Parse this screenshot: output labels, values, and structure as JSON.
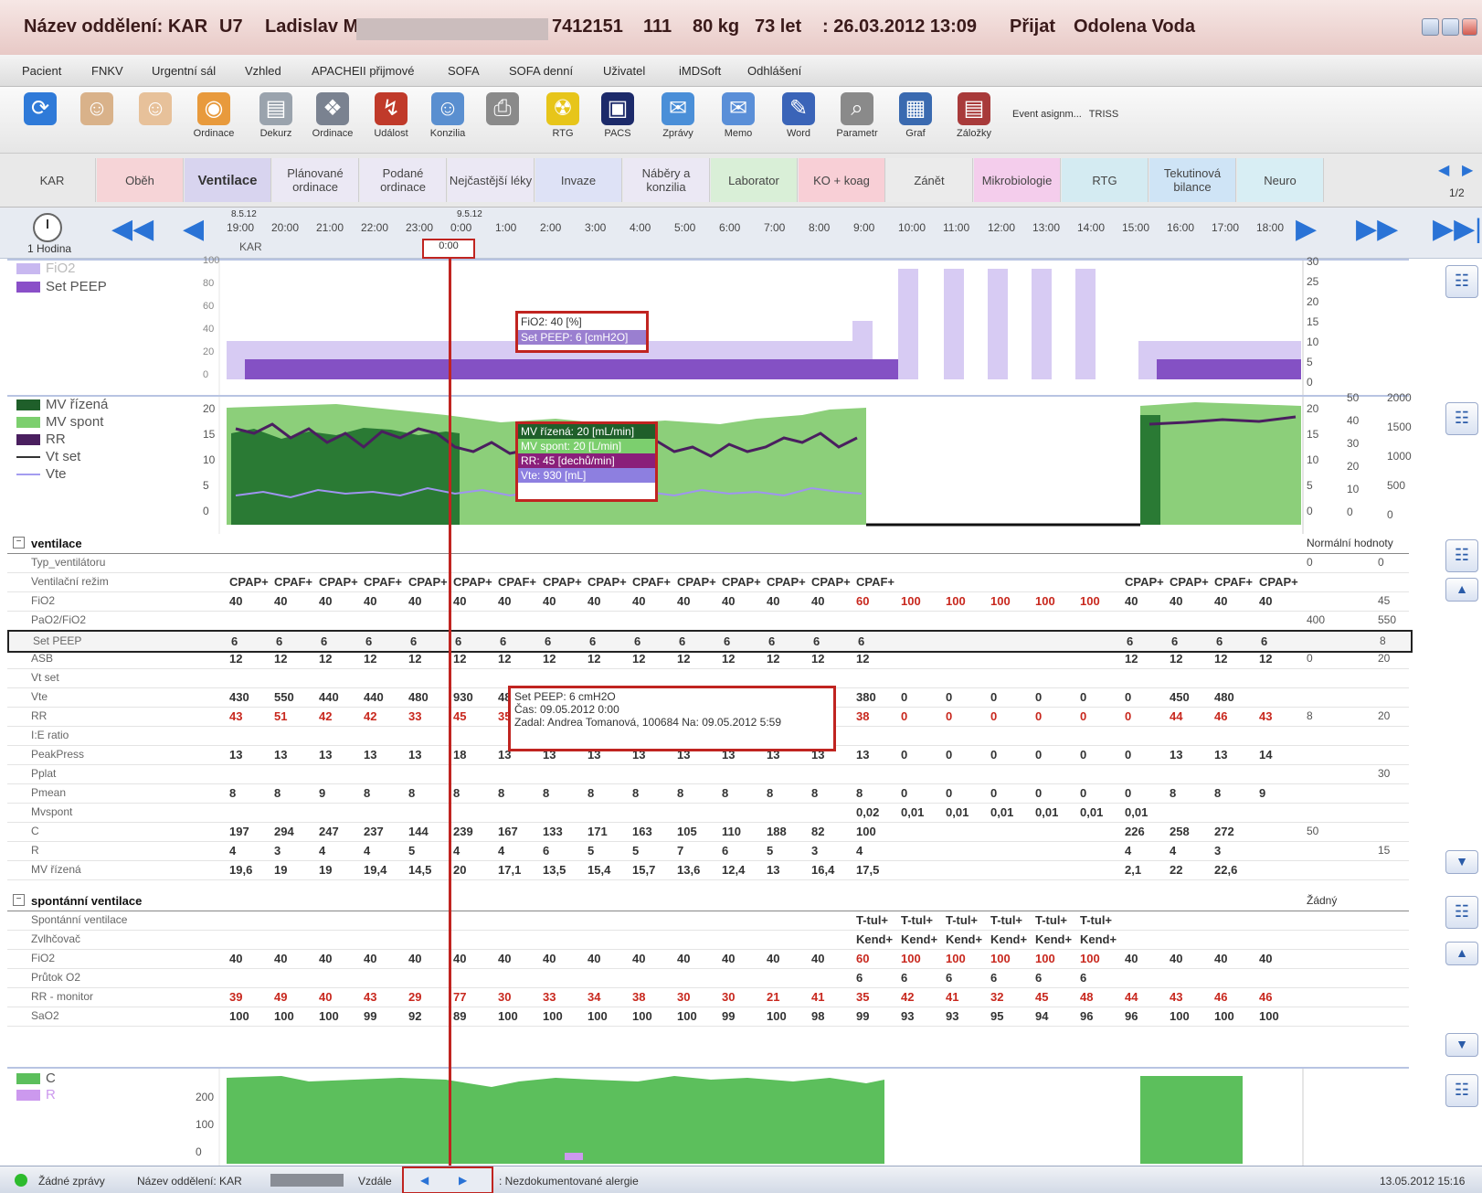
{
  "titlebar": {
    "department": "Název oddělení: KAR",
    "room": "U7",
    "patient": "Ladislav M.",
    "id": "7412151",
    "code": "111",
    "weight": "80 kg",
    "age": "73 let",
    "admitted": ": 26.03.2012 13:09",
    "status": "Přijat",
    "origin": "Odolena Voda"
  },
  "menu": [
    "Pacient",
    "FNKV",
    "Urgentní sál",
    "Vzhled",
    "APACHEII přijmové",
    "SOFA",
    "SOFA denní",
    "Uživatel",
    "iMDSoft",
    "Odhlášení"
  ],
  "toolbar": [
    "",
    "",
    "",
    "Ordinace",
    "Dekurz",
    "Ordinace",
    "Událost",
    "Konzilia",
    "",
    "RTG",
    "PACS",
    "Zprávy",
    "Memo",
    "Word",
    "Parametr",
    "Graf",
    "Záložky",
    "Event asignm...",
    "TRISS"
  ],
  "tabs": [
    {
      "label": "KAR",
      "color": "#e9e9e9"
    },
    {
      "label": "Oběh",
      "color": "#f6d4d7"
    },
    {
      "label": "Ventilace",
      "color": "#d8d4ef",
      "active": true
    },
    {
      "label": "Plánované ordinace",
      "color": "#ebe8f4"
    },
    {
      "label": "Podané ordinace",
      "color": "#ebe8f4"
    },
    {
      "label": "Nejčastější léky",
      "color": "#ebe8f4"
    },
    {
      "label": "Invaze",
      "color": "#dee2f6"
    },
    {
      "label": "Náběry a konzilia",
      "color": "#ebe8f4"
    },
    {
      "label": "Laborator",
      "color": "#d9efd7"
    },
    {
      "label": "KO + koag",
      "color": "#f8cfd6"
    },
    {
      "label": "Zánět",
      "color": "#ebebeb"
    },
    {
      "label": "Mikrobiologie",
      "color": "#f4cdec"
    },
    {
      "label": "RTG",
      "color": "#d4ebf2"
    },
    {
      "label": "Tekutinová bilance",
      "color": "#cfe4f6"
    },
    {
      "label": "Neuro",
      "color": "#d8eef4"
    }
  ],
  "tab_page": "1/2",
  "timebar": {
    "interval": "1 Hodina",
    "date1": "8.5.12",
    "date2": "9.5.12",
    "unit": "KAR",
    "cursor": "0:00",
    "hours": [
      "19:00",
      "20:00",
      "21:00",
      "22:00",
      "23:00",
      "0:00",
      "1:00",
      "2:00",
      "3:00",
      "4:00",
      "5:00",
      "6:00",
      "7:00",
      "8:00",
      "9:00",
      "10:00",
      "11:00",
      "12:00",
      "13:00",
      "14:00",
      "15:00",
      "16:00",
      "17:00",
      "18:00"
    ]
  },
  "chart1": {
    "legend": [
      {
        "name": "FiO2",
        "color": "#c8b8f0"
      },
      {
        "name": "Set PEEP",
        "color": "#8a4fc8"
      }
    ],
    "left_ticks": [
      "100",
      "80",
      "60",
      "40",
      "20",
      "0"
    ],
    "right_ticks": [
      "30",
      "25",
      "20",
      "15",
      "10",
      "5",
      "0"
    ],
    "tooltip": [
      "FiO2: 40 [%]",
      "Set PEEP: 6 [cmH2O]"
    ]
  },
  "chart2": {
    "legend": [
      {
        "name": "MV řízená",
        "color": "#1f5f2a"
      },
      {
        "name": "MV spont",
        "color": "#7ccf6e"
      },
      {
        "name": "RR",
        "color": "#4a1f5f"
      },
      {
        "name": "Vt set",
        "color": "#333333"
      },
      {
        "name": "Vte",
        "color": "#a49cf0"
      }
    ],
    "left_ticks": [
      "20",
      "15",
      "10",
      "5",
      "0"
    ],
    "right1": [
      "20",
      "15",
      "10",
      "5",
      "0"
    ],
    "right2": [
      "50",
      "40",
      "30",
      "20",
      "10",
      "0"
    ],
    "right3": [
      "2000",
      "1500",
      "1000",
      "500",
      "0"
    ],
    "tooltip": [
      "MV řízená: 20 [mL/min]",
      "MV spont: 20 [L/min]",
      "RR: 45 [dechů/min]",
      "Vte: 930 [mL]"
    ]
  },
  "ventilace": {
    "title": "ventilace",
    "normal_header": "Normální hodnoty",
    "rows": [
      {
        "label": "Typ_ventilátoru",
        "v": [],
        "n1": "0",
        "n2": "0"
      },
      {
        "label": "Ventilační režim",
        "v": [
          "CPAP+",
          "CPAF+",
          "CPAP+",
          "CPAF+",
          "CPAP+",
          "CPAP+",
          "CPAF+",
          "CPAP+",
          "CPAP+",
          "CPAF+",
          "CPAP+",
          "CPAP+",
          "CPAP+",
          "CPAP+",
          "CPAF+",
          "",
          "",
          "",
          "",
          "",
          "CPAP+",
          "CPAP+",
          "CPAF+",
          "CPAP+"
        ],
        "n1": "",
        "n2": ""
      },
      {
        "label": "FiO2",
        "v": [
          "40",
          "40",
          "40",
          "40",
          "40",
          "40",
          "40",
          "40",
          "40",
          "40",
          "40",
          "40",
          "40",
          "40",
          "60",
          "100",
          "100",
          "100",
          "100",
          "100",
          "40",
          "40",
          "40",
          "40"
        ],
        "red": [
          14,
          15,
          16,
          17,
          18,
          19
        ],
        "n1": "",
        "n2": "45"
      },
      {
        "label": "PaO2/FiO2",
        "v": [],
        "n1": "400",
        "n2": "550"
      },
      {
        "label": "Set PEEP",
        "v": [
          "6",
          "6",
          "6",
          "6",
          "6",
          "6",
          "6",
          "6",
          "6",
          "6",
          "6",
          "6",
          "6",
          "6",
          "6",
          "",
          "",
          "",
          "",
          "",
          "6",
          "6",
          "6",
          "6"
        ],
        "n1": "",
        "n2": "8"
      },
      {
        "label": "ASB",
        "v": [
          "12",
          "12",
          "12",
          "12",
          "12",
          "12",
          "12",
          "12",
          "12",
          "12",
          "12",
          "12",
          "12",
          "12",
          "12",
          "",
          "",
          "",
          "",
          "",
          "12",
          "12",
          "12",
          "12"
        ],
        "n1": "0",
        "n2": "20"
      },
      {
        "label": "Vt set",
        "v": [],
        "n1": "",
        "n2": ""
      },
      {
        "label": "Vte",
        "v": [
          "430",
          "550",
          "440",
          "440",
          "480",
          "930",
          "48",
          "",
          "",
          "",
          "",
          "",
          "",
          "",
          "380",
          "0",
          "0",
          "0",
          "0",
          "0",
          "0",
          "450",
          "480",
          ""
        ],
        "n1": "",
        "n2": ""
      },
      {
        "label": "RR",
        "v": [
          "43",
          "51",
          "42",
          "42",
          "33",
          "45",
          "35",
          "",
          "",
          "",
          "",
          "",
          "",
          "",
          "38",
          "0",
          "0",
          "0",
          "0",
          "0",
          "0",
          "44",
          "46",
          "43"
        ],
        "red": [
          0,
          1,
          2,
          3,
          4,
          5,
          6,
          14,
          15,
          16,
          17,
          18,
          19,
          20,
          21,
          22,
          23
        ],
        "n1": "8",
        "n2": "20"
      },
      {
        "label": "I:E ratio",
        "v": [],
        "n1": "",
        "n2": ""
      },
      {
        "label": "PeakPress",
        "v": [
          "13",
          "13",
          "13",
          "13",
          "13",
          "18",
          "13",
          "13",
          "13",
          "13",
          "13",
          "13",
          "13",
          "13",
          "13",
          "0",
          "0",
          "0",
          "0",
          "0",
          "0",
          "13",
          "13",
          "14"
        ],
        "n1": "",
        "n2": ""
      },
      {
        "label": "Pplat",
        "v": [],
        "n1": "",
        "n2": "30"
      },
      {
        "label": "Pmean",
        "v": [
          "8",
          "8",
          "9",
          "8",
          "8",
          "8",
          "8",
          "8",
          "8",
          "8",
          "8",
          "8",
          "8",
          "8",
          "8",
          "0",
          "0",
          "0",
          "0",
          "0",
          "0",
          "8",
          "8",
          "9"
        ],
        "n1": "",
        "n2": ""
      },
      {
        "label": "Mvspont",
        "v": [
          "",
          "",
          "",
          "",
          "",
          "",
          "",
          "",
          "",
          "",
          "",
          "",
          "",
          "",
          "0,02",
          "0,01",
          "0,01",
          "0,01",
          "0,01",
          "0,01",
          "0,01",
          "",
          "",
          ""
        ],
        "n1": "",
        "n2": ""
      },
      {
        "label": "C",
        "v": [
          "197",
          "294",
          "247",
          "237",
          "144",
          "239",
          "167",
          "133",
          "171",
          "163",
          "105",
          "110",
          "188",
          "82",
          "100",
          "",
          "",
          "",
          "",
          "",
          "226",
          "258",
          "272",
          ""
        ],
        "n1": "50",
        "n2": ""
      },
      {
        "label": "R",
        "v": [
          "4",
          "3",
          "4",
          "4",
          "5",
          "4",
          "4",
          "6",
          "5",
          "5",
          "7",
          "6",
          "5",
          "3",
          "4",
          "",
          "",
          "",
          "",
          "",
          "4",
          "4",
          "3",
          ""
        ],
        "n1": "",
        "n2": "15"
      },
      {
        "label": "MV řízená",
        "v": [
          "19,6",
          "19",
          "19",
          "19,4",
          "14,5",
          "20",
          "17,1",
          "13,5",
          "15,4",
          "15,7",
          "13,6",
          "12,4",
          "13",
          "16,4",
          "17,5",
          "",
          "",
          "",
          "",
          "",
          "2,1",
          "22",
          "22,6",
          ""
        ],
        "n1": "",
        "n2": ""
      }
    ]
  },
  "tooltip3": [
    "Set PEEP: 6 cmH2O",
    "Čas: 09.05.2012 0:00",
    "Zadal: Andrea Tomanová, 100684 Na: 09.05.2012 5:59"
  ],
  "spontanni": {
    "title": "spontánní ventilace",
    "normal_header": "Žádný",
    "rows": [
      {
        "label": "Spontánní ventilace",
        "v": [
          "",
          "",
          "",
          "",
          "",
          "",
          "",
          "",
          "",
          "",
          "",
          "",
          "",
          "",
          "T-tul+",
          "T-tul+",
          "T-tul+",
          "T-tul+",
          "T-tul+",
          "T-tul+",
          "",
          "",
          "",
          ""
        ]
      },
      {
        "label": "Zvlhčovač",
        "v": [
          "",
          "",
          "",
          "",
          "",
          "",
          "",
          "",
          "",
          "",
          "",
          "",
          "",
          "",
          "Kend+",
          "Kend+",
          "Kend+",
          "Kend+",
          "Kend+",
          "Kend+",
          "",
          "",
          "",
          ""
        ]
      },
      {
        "label": "FiO2",
        "v": [
          "40",
          "40",
          "40",
          "40",
          "40",
          "40",
          "40",
          "40",
          "40",
          "40",
          "40",
          "40",
          "40",
          "40",
          "60",
          "100",
          "100",
          "100",
          "100",
          "100",
          "40",
          "40",
          "40",
          "40"
        ],
        "red": [
          14,
          15,
          16,
          17,
          18,
          19
        ]
      },
      {
        "label": "Průtok O2",
        "v": [
          "",
          "",
          "",
          "",
          "",
          "",
          "",
          "",
          "",
          "",
          "",
          "",
          "",
          "",
          "6",
          "6",
          "6",
          "6",
          "6",
          "6",
          "",
          "",
          "",
          ""
        ]
      },
      {
        "label": "RR - monitor",
        "v": [
          "39",
          "49",
          "40",
          "43",
          "29",
          "77",
          "30",
          "33",
          "34",
          "38",
          "30",
          "30",
          "21",
          "41",
          "35",
          "42",
          "41",
          "32",
          "45",
          "48",
          "44",
          "43",
          "46",
          "46"
        ],
        "red": [
          0,
          1,
          2,
          3,
          4,
          5,
          6,
          7,
          8,
          9,
          10,
          11,
          12,
          13,
          14,
          15,
          16,
          17,
          18,
          19,
          20,
          21,
          22,
          23
        ]
      },
      {
        "label": "SaO2",
        "v": [
          "100",
          "100",
          "100",
          "99",
          "92",
          "89",
          "100",
          "100",
          "100",
          "100",
          "100",
          "99",
          "100",
          "98",
          "99",
          "93",
          "93",
          "95",
          "94",
          "96",
          "96",
          "100",
          "100",
          "100"
        ]
      }
    ]
  },
  "chart4": {
    "legend": [
      {
        "name": "C",
        "color": "#5cbf5c"
      },
      {
        "name": "R",
        "color": "#cc99ee"
      }
    ],
    "left_ticks": [
      "200",
      "100",
      "0"
    ]
  },
  "statusbar": {
    "messages": "Žádné zprávy",
    "department": "Název oddělení: KAR",
    "remote": "Vzdále",
    "allergies": ": Nezdokumentované alergie",
    "datetime": "13.05.2012 15:16"
  }
}
